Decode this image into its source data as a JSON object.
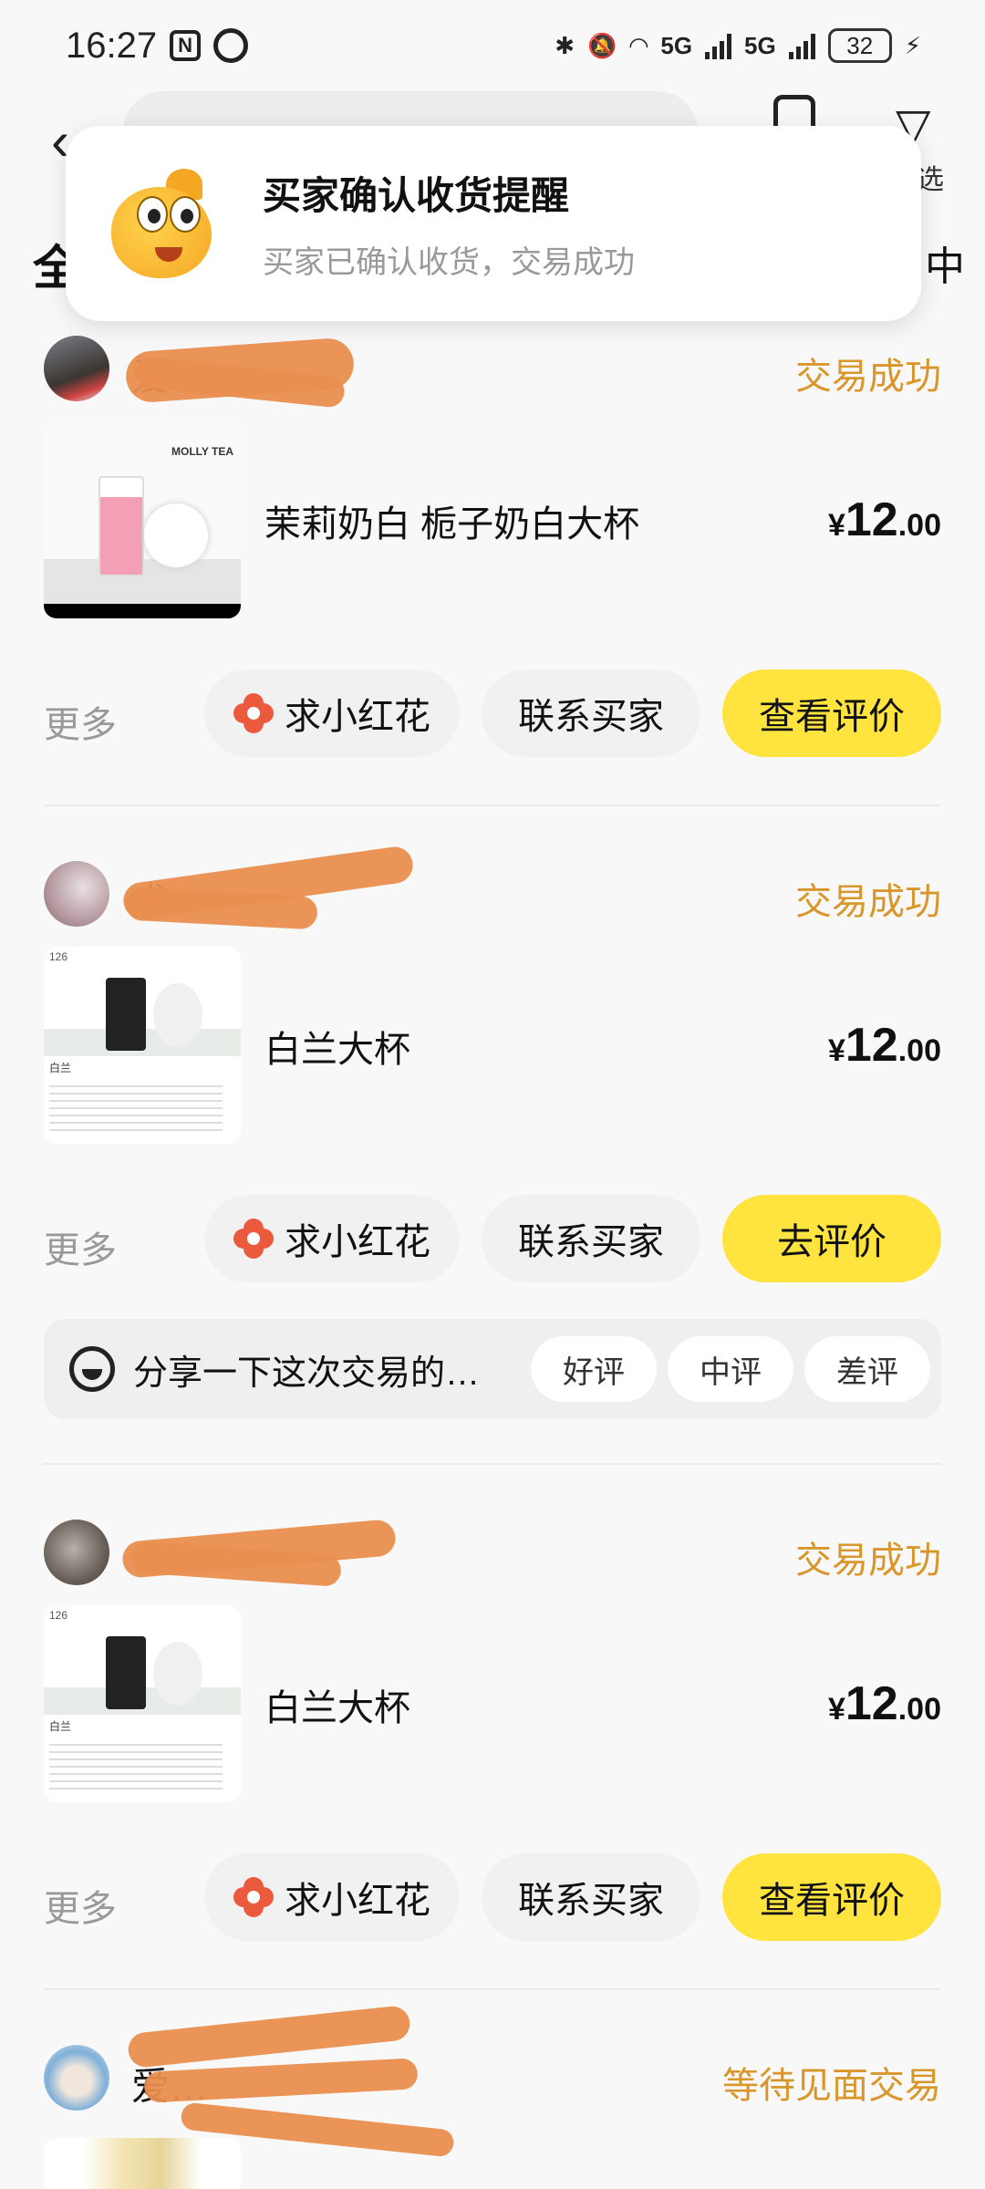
{
  "status_bar": {
    "time": "16:27",
    "nfc": "N",
    "net1": "5G",
    "net2": "5G",
    "battery": "32"
  },
  "header": {
    "filter_label": "选",
    "tab_left": "全",
    "tab_right": "中"
  },
  "notification": {
    "title": "买家确认收货提醒",
    "subtitle": "买家已确认收货，交易成功"
  },
  "orders": [
    {
      "user": "爱",
      "status": "交易成功",
      "title": "茉莉奶白 栀子奶白大杯",
      "price_yen": "¥",
      "price_int": "12",
      "price_dec": ".00",
      "more": "更多",
      "flower_label": "求小红花",
      "contact_label": "联系买家",
      "primary_label": "查看评价"
    },
    {
      "user": "求",
      "status": "交易成功",
      "title": "白兰大杯",
      "price_yen": "¥",
      "price_int": "12",
      "price_dec": ".00",
      "more": "更多",
      "flower_label": "求小红花",
      "contact_label": "联系买家",
      "primary_label": "去评价"
    },
    {
      "user": "",
      "status": "交易成功",
      "title": "白兰大杯",
      "price_yen": "¥",
      "price_int": "12",
      "price_dec": ".00",
      "more": "更多",
      "flower_label": "求小红花",
      "contact_label": "联系买家",
      "primary_label": "查看评价"
    },
    {
      "user": "爱…",
      "status": "等待见面交易"
    }
  ],
  "review_prompt": {
    "text": "分享一下这次交易的…",
    "good": "好评",
    "neutral": "中评",
    "bad": "差评"
  },
  "thumbnails": {
    "brand": "MOLLY TEA",
    "size_label": "126",
    "caption": "白兰"
  },
  "colors": {
    "accent_yellow": "#ffe43f",
    "status_orange": "#d9962a",
    "flower_red": "#ec5a3e"
  }
}
